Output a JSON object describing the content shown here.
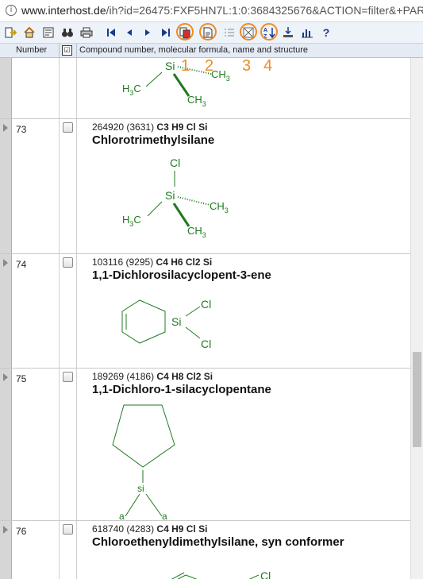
{
  "browser": {
    "url_host": "www.interhost.de",
    "url_rest": "/ih?id=26475:FXF5HN7L:1:0:3684325676&ACTION=filter&+PAR"
  },
  "toolbar": {
    "buttons": [
      "exit-icon",
      "home-icon",
      "form-icon",
      "binoculars-icon",
      "print-icon",
      "first-page-icon",
      "previous-icon",
      "next-icon",
      "last-page-icon",
      "copy-icon",
      "document-icon",
      "list-icon",
      "clear-selection-icon",
      "sort-icon",
      "download-icon",
      "chart-icon",
      "help-icon"
    ],
    "help_label": "?"
  },
  "annotations": [
    "1",
    "2",
    "3",
    "4"
  ],
  "table": {
    "headers": {
      "number": "Number",
      "checkbox": "☑",
      "description": "Compound number, molecular formula, name and structure"
    },
    "rows": [
      {
        "number": "",
        "id": "",
        "count": "",
        "formula": "",
        "name": ""
      },
      {
        "number": "73",
        "id": "264920",
        "count": "(3631)",
        "formula": "C3 H9 Cl Si",
        "name": "Chlorotrimethylsilane"
      },
      {
        "number": "74",
        "id": "103116",
        "count": "(9295)",
        "formula": "C4 H6 Cl2 Si",
        "name": "1,1-Dichlorosilacyclopent-3-ene"
      },
      {
        "number": "75",
        "id": "189269",
        "count": "(4186)",
        "formula": "C4 H8 Cl2 Si",
        "name": "1,1-Dichloro-1-silacyclopentane"
      },
      {
        "number": "76",
        "id": "618740",
        "count": "(4283)",
        "formula": "C4 H9 Cl Si",
        "name": "Chloroethenyldimethylsilane, syn conformer"
      }
    ]
  },
  "structure_labels": {
    "si": "Si",
    "si_lower": "si",
    "cl": "Cl",
    "cl_lower": "a",
    "ch3_c": "CH",
    "ch3_3": "3",
    "h3c_h": "H",
    "h3c_3": "3",
    "h3c_c": "C"
  },
  "colors": {
    "annotation": "#f08a24",
    "structure_green": "#1f7a1f",
    "toolbar_bg": "#eef3fa"
  }
}
